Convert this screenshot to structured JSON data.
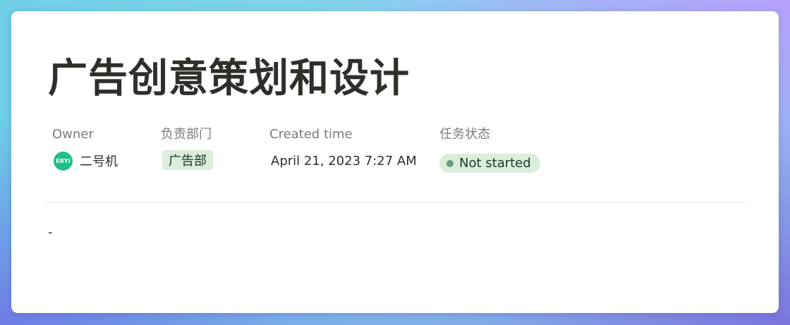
{
  "page": {
    "title": "广告创意策划和设计",
    "body_text": "-"
  },
  "properties": {
    "owner": {
      "label": "Owner",
      "avatar_initials": "ERYI",
      "name": "二号机"
    },
    "department": {
      "label": "负责部门",
      "value": "广告部"
    },
    "created_time": {
      "label": "Created time",
      "value": "April 21, 2023 7:27 AM"
    },
    "task_status": {
      "label": "任务状态",
      "value": "Not started"
    }
  },
  "colors": {
    "tag_background": "#dbeddb",
    "tag_text": "#1c3829",
    "status_dot": "#6c9b7d",
    "avatar_background": "#1fbf8a"
  }
}
